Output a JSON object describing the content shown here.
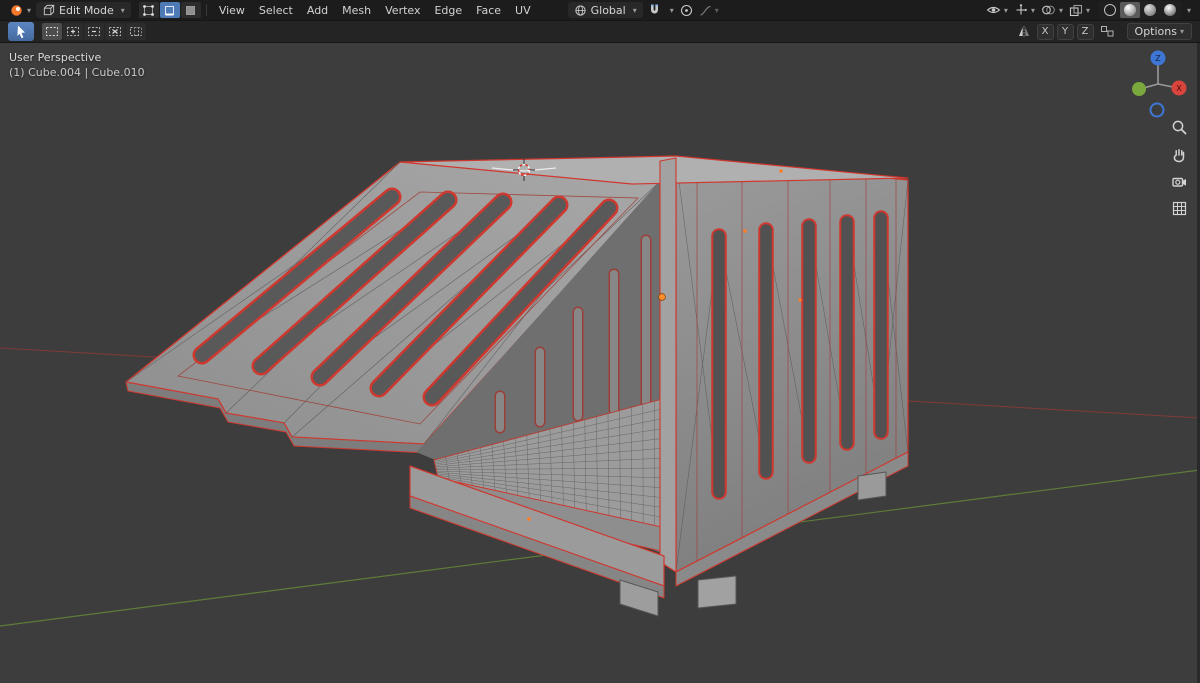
{
  "topbar": {
    "mode_label": "Edit Mode",
    "menus": [
      "View",
      "Select",
      "Add",
      "Mesh",
      "Vertex",
      "Edge",
      "Face",
      "UV"
    ],
    "orientation_label": "Global"
  },
  "tool_settings": {
    "mirror_axes": [
      "X",
      "Y",
      "Z"
    ],
    "options_label": "Options"
  },
  "viewport": {
    "perspective_label": "User Perspective",
    "object_info": "(1) Cube.004 | Cube.010",
    "gizmo": {
      "x_label": "X",
      "z_label": "Z"
    }
  },
  "colors": {
    "selected_edge": "#cf382e",
    "viewport_background": "#3d3d3d",
    "header_background": "#1c1c1c",
    "active_tool_blue": "#4e7ab5",
    "axis_x_line": "#7c3b38",
    "axis_y_line": "#5e7c39",
    "vertex_orange": "#ff8c2a",
    "mesh_gray": "#929292"
  }
}
